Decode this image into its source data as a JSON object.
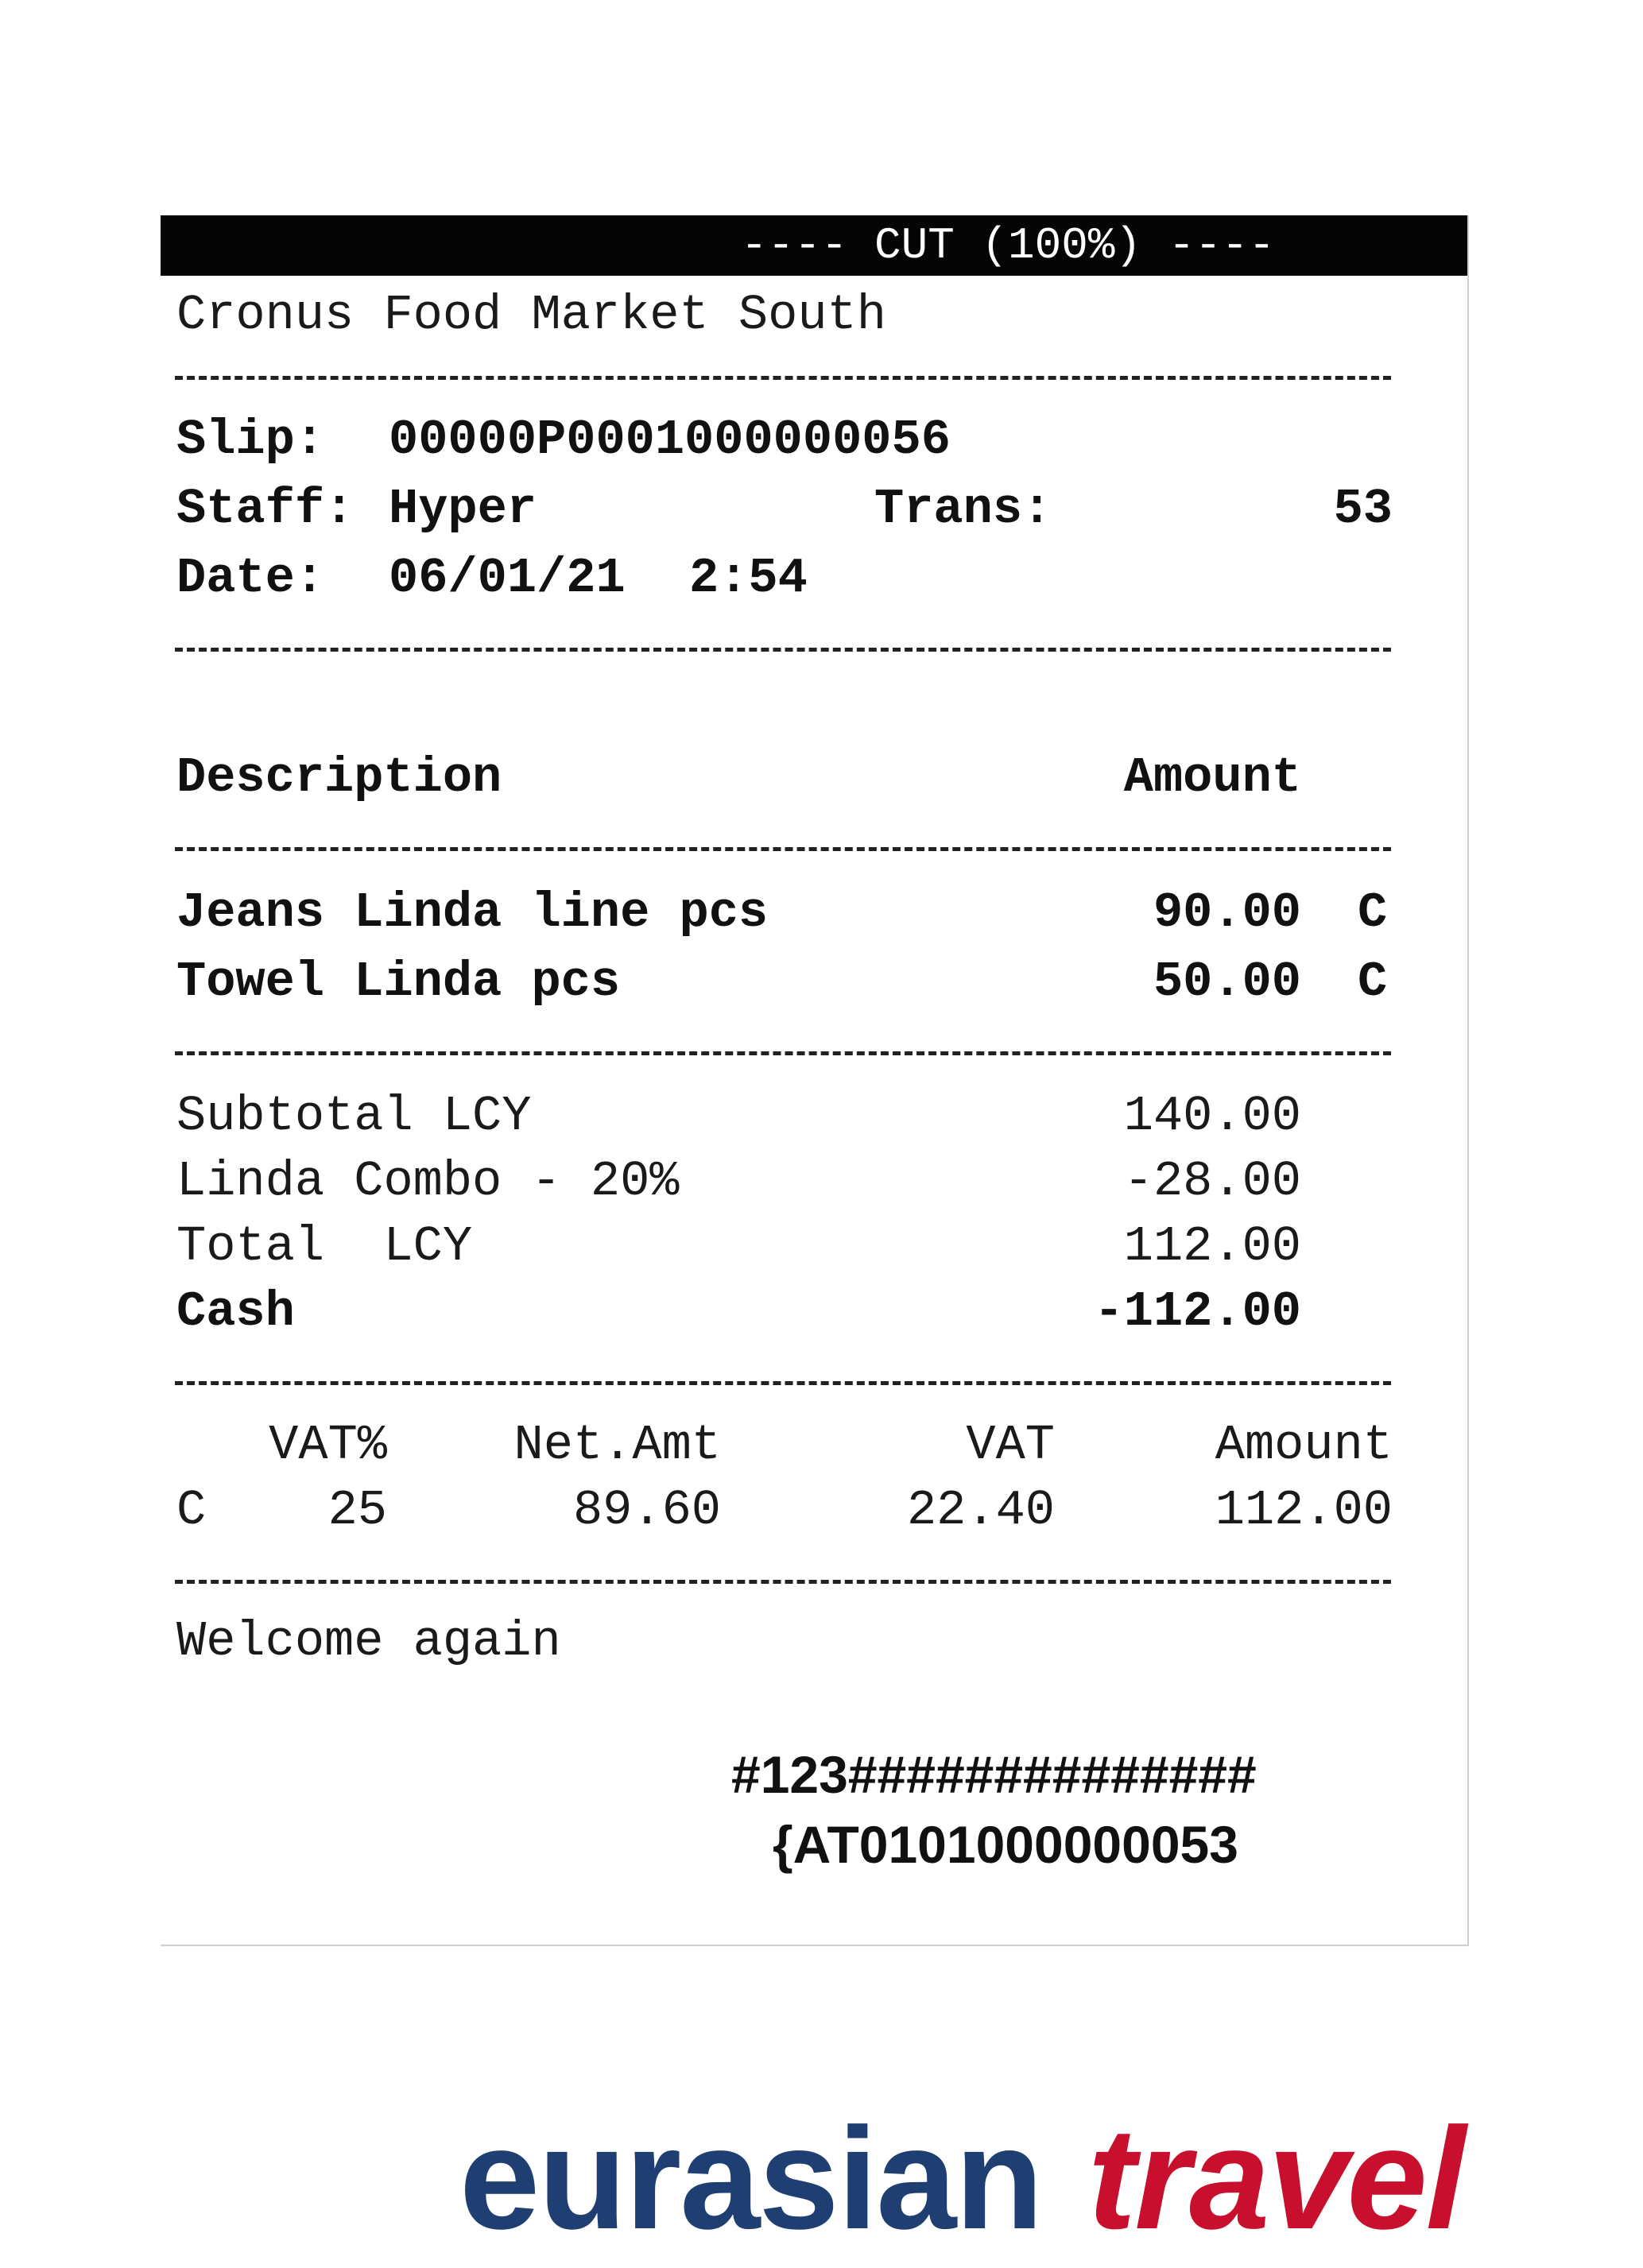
{
  "header": {
    "cut_label": "---- CUT (100%) ----"
  },
  "store": {
    "name": "Cronus Food Market South"
  },
  "info": {
    "slip_label": "Slip:",
    "slip_value": "00000P0001000000056",
    "staff_label": "Staff:",
    "staff_value": "Hyper",
    "trans_label": "Trans:",
    "trans_value": "53",
    "date_label": "Date:",
    "date_value": "06/01/21",
    "time_value": "2:54"
  },
  "columns": {
    "description": "Description",
    "amount": "Amount"
  },
  "items": [
    {
      "description": "Jeans Linda line pcs",
      "amount": "90.00",
      "vat_code": "C"
    },
    {
      "description": "Towel Linda pcs",
      "amount": "50.00",
      "vat_code": "C"
    }
  ],
  "totals": {
    "subtotal_label": "Subtotal LCY",
    "subtotal_value": "140.00",
    "discount_label": "Linda Combo - 20%",
    "discount_value": "-28.00",
    "total_label": "Total  LCY",
    "total_value": "112.00",
    "cash_label": "Cash",
    "cash_value": "-112.00"
  },
  "vat_table": {
    "headers": {
      "vat_pct": "VAT%",
      "net_amt": "Net.Amt",
      "vat": "VAT",
      "amount": "Amount"
    },
    "row": {
      "code": "C",
      "vat_pct": "25",
      "net_amt": "89.60",
      "vat": "22.40",
      "amount": "112.00"
    }
  },
  "footer": {
    "message": "Welcome again",
    "barcode_line1": "#123##############",
    "barcode_line2": "{AT0101000000053"
  },
  "logo": {
    "word1": "eurasian",
    "word2": "travel"
  }
}
